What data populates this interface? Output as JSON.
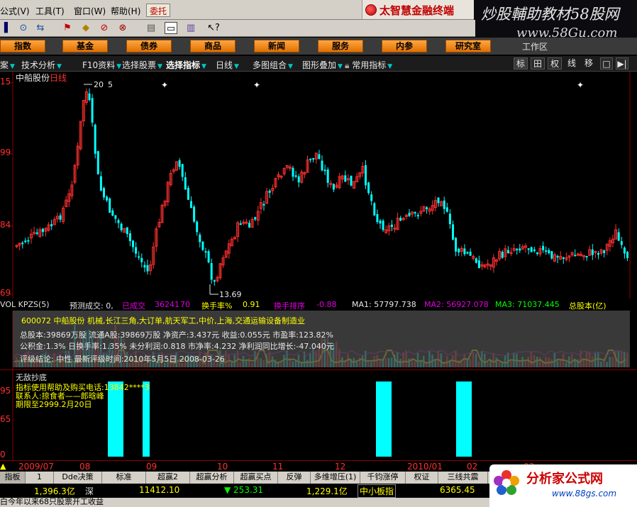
{
  "menu": {
    "items": [
      "公式(V)",
      "工具(T)",
      "窗口(W)",
      "帮助(H)"
    ],
    "weituo": "委托",
    "app_title": "太智慧金融终端"
  },
  "watermark_top": {
    "line1": "炒股輔助教材58股网",
    "line2": "www.58Gu.com"
  },
  "categories": [
    "指数",
    "基金",
    "债券",
    "商品",
    "新闻",
    "服务",
    "内参",
    "研究室"
  ],
  "workarea": "工作区",
  "bar2": {
    "items": [
      "案",
      "技术分析",
      "F10资料",
      "选择股票",
      "选择指标",
      "日线",
      "多图组合",
      "图形叠加",
      "常用指标"
    ],
    "right_buttons": [
      "标",
      "田",
      "权",
      "线",
      "移",
      "□",
      "▶|"
    ]
  },
  "chart": {
    "stock_name": "中船股份",
    "period": "日线",
    "y_labels": [
      "15",
      "99",
      "84",
      "69"
    ],
    "high_label": "20",
    "low_label": "13.69",
    "marker_5": "5"
  },
  "volrow": {
    "label": "VOL KPZS(5)",
    "forecast": "预测成交: 0,",
    "done_label": "已成交",
    "done_value": "36241",
    "v70": "70",
    "turnover": "换手率%",
    "turnover_val": "0.91",
    "rank": "换手排序",
    "rank_val": "-0.88",
    "ma1": "MA1: 57797.738",
    "ma2": "MA2: 56927.078",
    "ma3": "MA3: 71037.445",
    "capital": "总股本(亿)"
  },
  "f10": {
    "line1": "600072 中船股份 机械,长江三角,大订单,航天军工,中价,上海,交通运输设备制造业",
    "line2": "总股本:39869万股 流通A股:39869万股 净资产:3.437元 收益:0.055元 市盈率:123.82%",
    "line3": "公积金:1.3%  日换手率:1.35%  未分利润:0.818  市净率:4.232  净利润同比增长:-47.040元",
    "line4": "评级结论:  中性  最新评级时间:2010年5月5日 2008-03-26"
  },
  "indicator": {
    "title": "无敌抄底",
    "line1": "指标使用帮助及购买电话:13842****3",
    "line2": "联系人:掠食者——郎晗峰",
    "line3": "期限至2999.2月20日",
    "y_labels": [
      "95",
      "65",
      "0"
    ]
  },
  "dates": [
    "2009/07",
    "08",
    "09",
    "10",
    "11",
    "12",
    "2010/01",
    "02",
    "03"
  ],
  "tabs": [
    "指板",
    "1",
    "Dde决策",
    "标准",
    "超赢2",
    "超赢分析",
    "超赢买点",
    "反弹",
    "多维增压(1)",
    "千钧涨停",
    "权证",
    "三线共震"
  ],
  "index_row": {
    "val1": "1,396.3亿",
    "shen": "深",
    "val2": "11412.10",
    "val3": "▼ 253.31",
    "val4": "1,229.1亿",
    "zxb": "中小板指",
    "val5": "6365.45"
  },
  "marquee": "白今年以来68只股票开工收益",
  "watermark_bottom": {
    "title": "分析家公式网",
    "url": "www.88gs.com"
  },
  "colors": {
    "up": "#ff3030",
    "down": "#00ffff",
    "accent": "#ffa642",
    "yellow": "#ffff00"
  }
}
